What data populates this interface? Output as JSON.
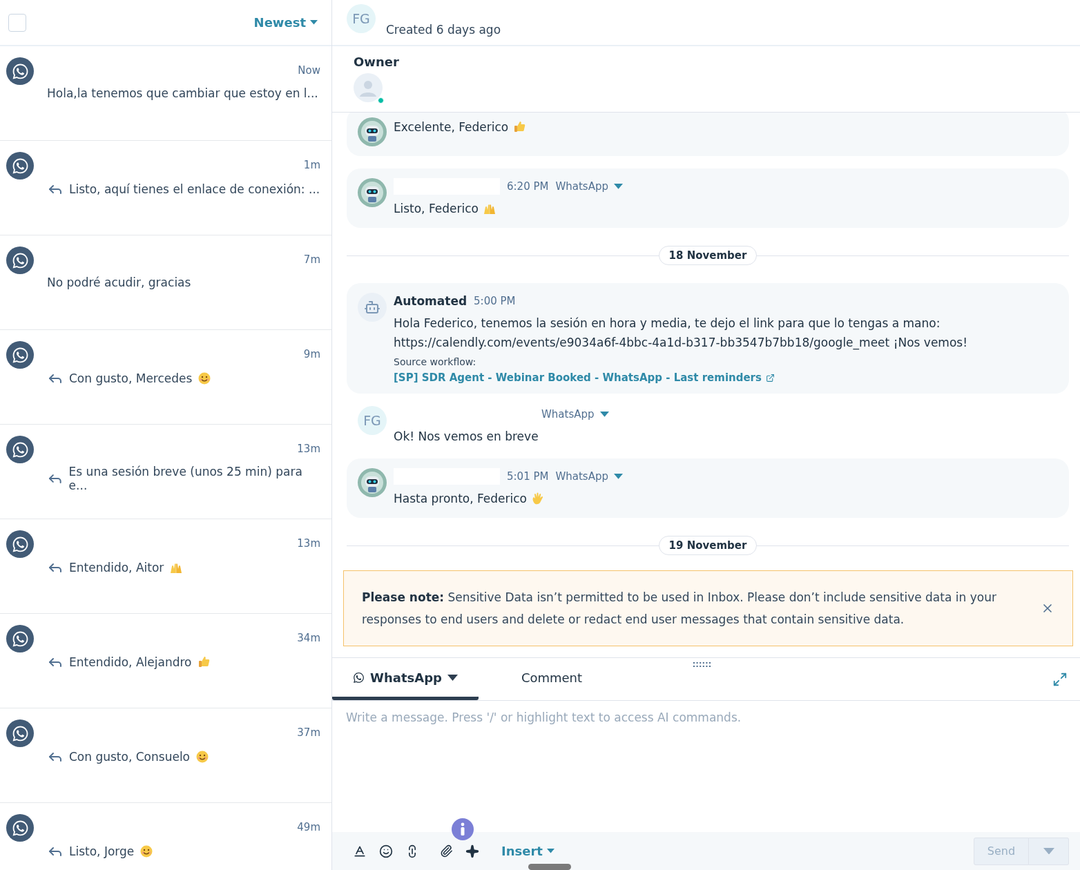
{
  "inbox": {
    "select_all": {
      "checked": false
    },
    "sort": {
      "label": "Newest"
    },
    "conversations": [
      {
        "time": "Now",
        "preview": "Hola,la tenemos que cambiar que estoy en l...",
        "replied": false
      },
      {
        "time": "1m",
        "preview": "Listo, aquí tienes el enlace de conexión: ...",
        "replied": true
      },
      {
        "time": "7m",
        "preview": "No podré acudir, gracias",
        "replied": false
      },
      {
        "time": "9m",
        "preview": "Con gusto, Mercedes",
        "replied": true,
        "emoji": {
          "kind": "smile"
        }
      },
      {
        "time": "13m",
        "preview": "Es una sesión breve (unos 25 min) para e...",
        "replied": true
      },
      {
        "time": "13m",
        "preview": "Entendido, Aitor",
        "replied": true,
        "emoji": {
          "kind": "raised_hands"
        }
      },
      {
        "time": "34m",
        "preview": "Entendido, Alejandro",
        "replied": true,
        "emoji": {
          "kind": "thumbs_up"
        }
      },
      {
        "time": "37m",
        "preview": "Con gusto, Consuelo",
        "replied": true,
        "emoji": {
          "kind": "smile"
        }
      },
      {
        "time": "49m",
        "preview": "Listo, Jorge",
        "replied": true,
        "emoji": {
          "kind": "smile"
        }
      }
    ]
  },
  "header": {
    "initials": "FG",
    "created": "Created 6 days ago"
  },
  "owner": {
    "label": "Owner",
    "online": true
  },
  "thread": [
    {
      "kind": "message",
      "avatar": {
        "kind": "bot_photo"
      },
      "text": "Excelente, Federico",
      "emoji": {
        "kind": "thumbs_up"
      },
      "bubble": true
    },
    {
      "kind": "message",
      "avatar": {
        "kind": "bot_photo"
      },
      "redacted_name": true,
      "time": "6:20 PM",
      "channel": "WhatsApp",
      "text": "Listo, Federico",
      "emoji": {
        "kind": "raised_hands"
      },
      "bubble": true
    },
    {
      "kind": "date",
      "label": "18 November"
    },
    {
      "kind": "message",
      "avatar": {
        "kind": "robot"
      },
      "sender": "Automated",
      "time": "5:00 PM",
      "text": "Hola Federico, tenemos la sesión en hora y media, te dejo el link para que lo tengas a mano: https://calendly.com/events/e9034a6f-4bbc-4a1d-b317-bb3547b7bb18/google_meet ¡Nos vemos!",
      "source_label": "Source workflow:",
      "source_link": "[SP] SDR Agent - Webinar Booked - WhatsApp - Last reminders",
      "bubble": true
    },
    {
      "kind": "message",
      "avatar": {
        "kind": "initials",
        "initials": "FG"
      },
      "channel": "WhatsApp",
      "text": "Ok! Nos vemos en breve",
      "bubble": false
    },
    {
      "kind": "message",
      "avatar": {
        "kind": "bot_photo"
      },
      "redacted_name": true,
      "time": "5:01 PM",
      "channel": "WhatsApp",
      "text": "Hasta pronto, Federico",
      "emoji": {
        "kind": "waving_hand"
      },
      "bubble": true
    },
    {
      "kind": "date",
      "label": "19 November"
    }
  ],
  "notice": {
    "text": "**Please note:** Sensitive Data isn’t permitted to be used in Inbox. Please don’t include sensitive data in your responses to end users and delete or redact end user messages that contain sensitive data."
  },
  "composer": {
    "tabs": [
      {
        "label": "WhatsApp",
        "selected": true,
        "kind": "channel"
      },
      {
        "label": "Comment",
        "selected": false,
        "kind": "plain"
      }
    ],
    "placeholder": "Write a message. Press '/' or highlight text to access AI commands.",
    "insert": "Insert",
    "send": {
      "label": "Send",
      "disabled": true
    }
  }
}
